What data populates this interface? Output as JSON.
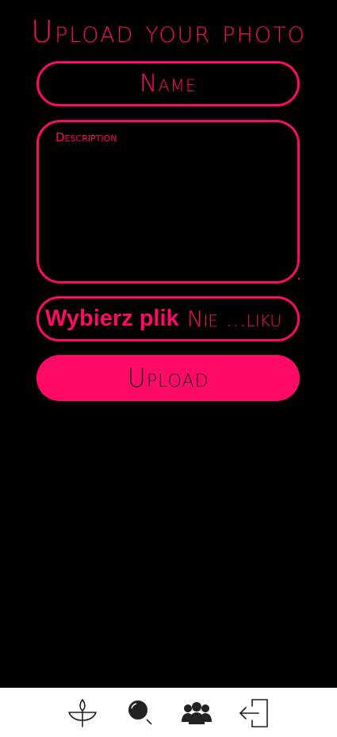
{
  "page": {
    "title": "Upload your photo"
  },
  "form": {
    "name_placeholder": "Name",
    "description_placeholder": "Description",
    "file_button_label": "Wybierz plik",
    "file_status": "Nie ...liku",
    "upload_label": "Upload"
  },
  "bottom_nav": {
    "items": [
      {
        "icon": "plant-icon"
      },
      {
        "icon": "search-icon"
      },
      {
        "icon": "users-icon"
      },
      {
        "icon": "logout-icon"
      }
    ]
  },
  "colors": {
    "accent": "#ff0a66",
    "background": "#000000",
    "nav_background": "#ffffff",
    "nav_icon": "#222222"
  }
}
